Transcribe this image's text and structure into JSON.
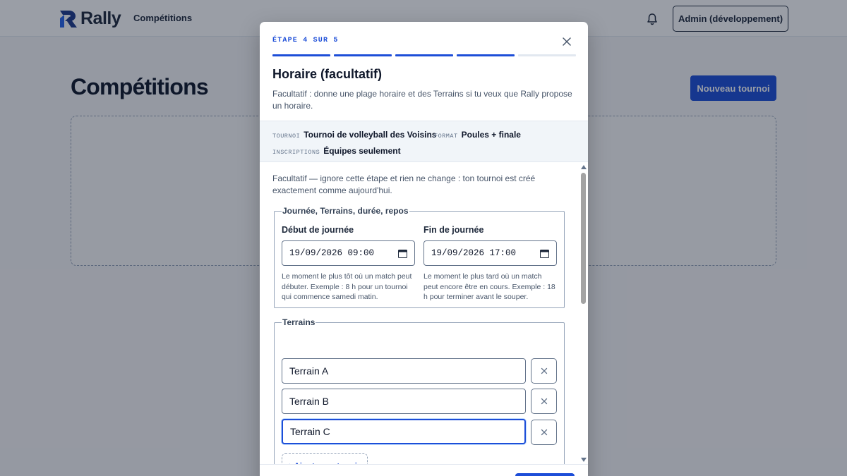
{
  "app": {
    "name": "Rally",
    "nav_link": "Compétitions",
    "user_button": "Admin (développement)",
    "icons": {
      "logo": "rally-logo-icon",
      "notifications": "bell-icon"
    },
    "colors": {
      "accent": "#1d4ed8",
      "text": "#0f172a"
    }
  },
  "page": {
    "title": "Compétitions",
    "new_button": "Nouveau tournoi"
  },
  "modal": {
    "step_label": "ÉTAPE 4 SUR 5",
    "step_current": 4,
    "step_total": 5,
    "title": "Horaire (facultatif)",
    "description": "Facultatif : donne une plage horaire et des Terrains si tu veux que Rally propose un horaire.",
    "summary": {
      "tournament_key": "TOURNOI",
      "tournament_value": "Tournoi de volleyball des Voisins",
      "format_key": "FORMAT",
      "format_value": "Poules + finale",
      "registration_key": "INSCRIPTIONS",
      "registration_value": "Équipes seulement"
    },
    "intro": "Facultatif — ignore cette étape et rien ne change : ton tournoi est créé exactement comme aujourd'hui.",
    "schedule_group": {
      "legend": "Journée, Terrains, durée, repos",
      "start_label": "Début de journée",
      "start_value": "19/09/2026 09:00",
      "start_help": "Le moment le plus tôt où un match peut débuter. Exemple : 8 h pour un tournoi qui commence samedi matin.",
      "end_label": "Fin de journée",
      "end_value": "19/09/2026 17:00",
      "end_help": "Le moment le plus tard où un match peut encore être en cours. Exemple : 18 h pour terminer avant le souper."
    },
    "courts_group": {
      "legend": "Terrains",
      "courts": [
        "Terrain A",
        "Terrain B",
        "Terrain C"
      ],
      "add_button": "+ Ajouter un terrain"
    }
  }
}
